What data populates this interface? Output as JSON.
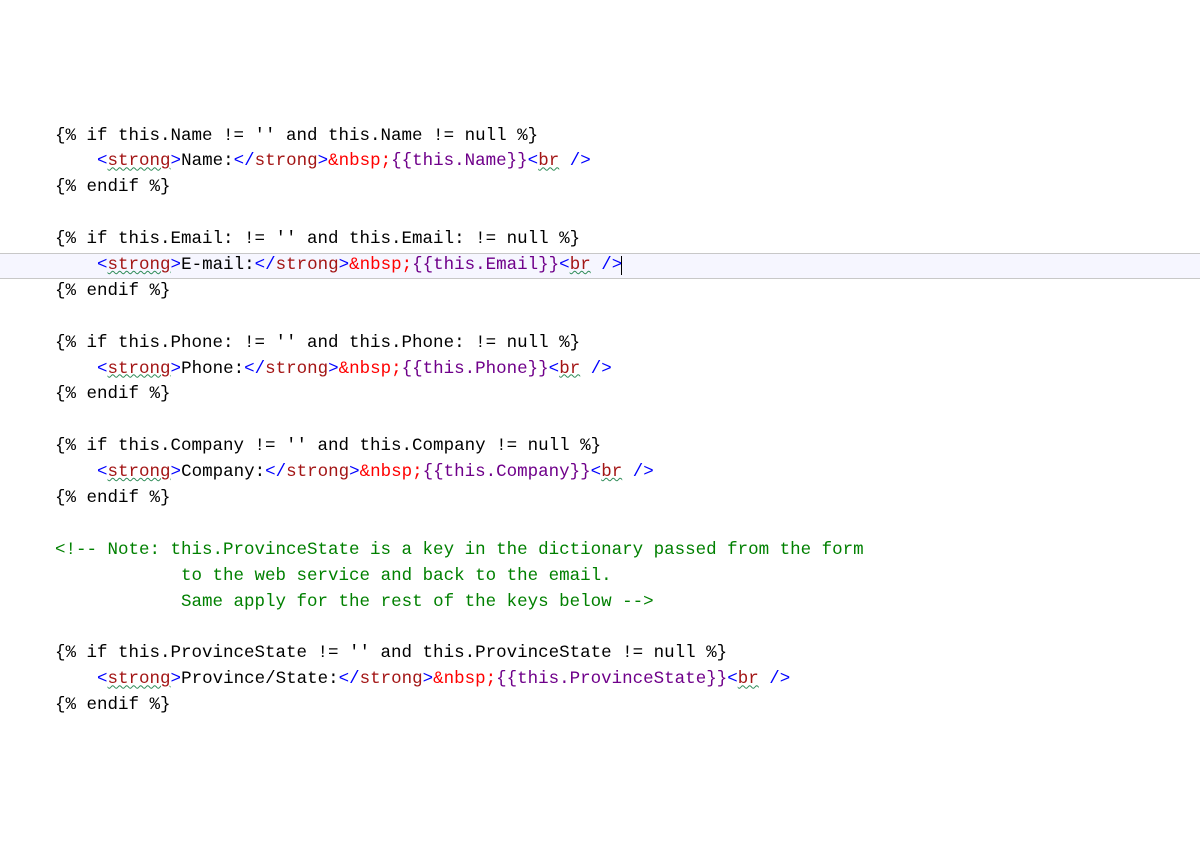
{
  "code": {
    "if_name": "{% if this.Name != '' and this.Name != null %}",
    "if_email": "{% if this.Email: != '' and this.Email: != null %}",
    "if_phone": "{% if this.Phone: != '' and this.Phone: != null %}",
    "if_company": "{% if this.Company != '' and this.Company != null %}",
    "if_province": "{% if this.ProvinceState != '' and this.ProvinceState != null %}",
    "endif": "{% endif %}",
    "indent": "    ",
    "comment_indent": "            ",
    "lt": "<",
    "gt": ">",
    "slashgt": "/>",
    "closelt": "</",
    "tag_strong": "strong",
    "tag_br": "br",
    "space": " ",
    "nbsp": "&nbsp;",
    "label_name": "Name:",
    "label_email": "E-mail:",
    "label_phone": "Phone:",
    "label_company": "Company:",
    "label_province": "Province/State:",
    "expr_name": "{{this.Name}}",
    "expr_email": "{{this.Email}}",
    "expr_phone": "{{this.Phone}}",
    "expr_company": "{{this.Company}}",
    "expr_province": "{{this.ProvinceState}}",
    "comment1": "<!-- Note: this.ProvinceState is a key in the dictionary passed from the form",
    "comment2": "to the web service and back to the email.",
    "comment3": "Same apply for the rest of the keys below -->"
  }
}
